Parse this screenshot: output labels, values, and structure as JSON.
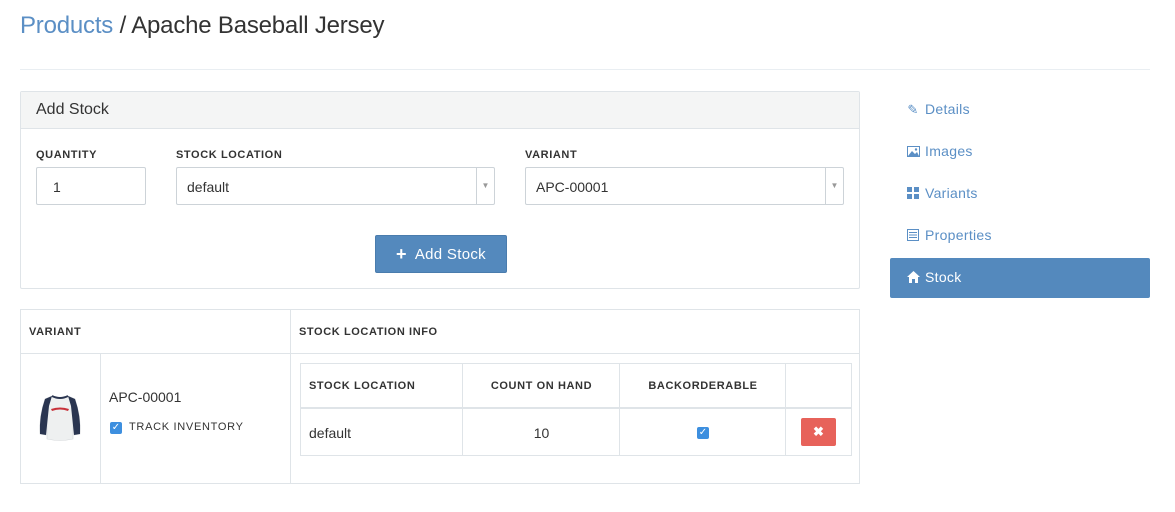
{
  "breadcrumb": {
    "parent": "Products",
    "separator": "/",
    "current": "Apache Baseball Jersey"
  },
  "add_stock": {
    "title": "Add Stock",
    "quantity_label": "QUANTITY",
    "quantity_value": "1",
    "location_label": "STOCK LOCATION",
    "location_value": "default",
    "variant_label": "VARIANT",
    "variant_value": "APC-00001",
    "button_label": "Add Stock"
  },
  "stock_table": {
    "headers": {
      "variant": "VARIANT",
      "location_info": "STOCK LOCATION INFO"
    },
    "inner_headers": {
      "location": "STOCK LOCATION",
      "count": "COUNT ON HAND",
      "backorderable": "BACKORDERABLE"
    },
    "row": {
      "sku": "APC-00001",
      "track_inventory": "TRACK INVENTORY",
      "track_inventory_checked": true,
      "location": "default",
      "count_on_hand": "10",
      "backorderable_checked": true
    }
  },
  "sidebar": {
    "items": [
      {
        "label": "Details",
        "icon": "pencil-icon"
      },
      {
        "label": "Images",
        "icon": "image-icon"
      },
      {
        "label": "Variants",
        "icon": "grid-icon"
      },
      {
        "label": "Properties",
        "icon": "list-icon"
      },
      {
        "label": "Stock",
        "icon": "home-icon",
        "active": true
      }
    ]
  },
  "colors": {
    "link": "#5b8fc5",
    "primary": "#5489bd",
    "danger": "#e7625a",
    "checkbox": "#3d8fdf"
  }
}
